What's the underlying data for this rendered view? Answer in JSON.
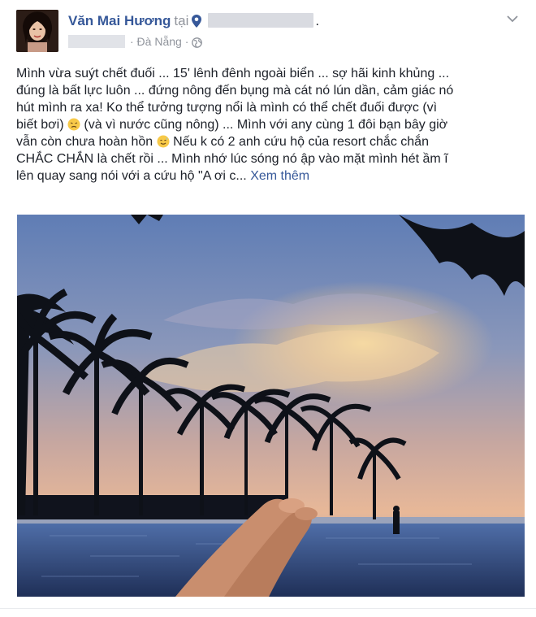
{
  "post": {
    "author": {
      "name": "Văn Mai Hương",
      "at_word": "tại"
    },
    "location_separator": ".",
    "meta": {
      "place": "· Đà Nẵng ·"
    },
    "text_lines": [
      "Mình vừa suýt chết đuối ... 15' lênh đênh ngoài biển ... sợ hãi kinh khủng ...",
      "đúng là bất lực luôn ... đứng nông đến bụng mà cát nó lún dần, cảm giác nó",
      "hút mình ra xa! Ko thể tưởng tượng nổi là mình có thể chết đuối được (vì",
      "biết bơi) ",
      " (và vì nước cũng nông) ... Mình với any cùng 1 đôi bạn bây giờ",
      "vẫn còn chưa hoàn hồn ",
      " Nếu k có 2 anh cứu hộ của resort chắc chắn",
      "CHẮC CHẮN là chết rồi ... Mình nhớ lúc sóng nó ập vào mặt mình hét ầm ĩ",
      "lên quay sang nói với a cứu hộ \"A ơi c... "
    ],
    "see_more": "Xem thêm",
    "icons": {
      "location": "map-pin-icon",
      "privacy": "globe-icon",
      "menu": "chevron-down-icon",
      "emoji_1": "tired-face-emoji",
      "emoji_2": "sweat-smile-emoji"
    },
    "colors": {
      "link": "#365899",
      "meta": "#90949c",
      "text": "#1d2129"
    }
  }
}
